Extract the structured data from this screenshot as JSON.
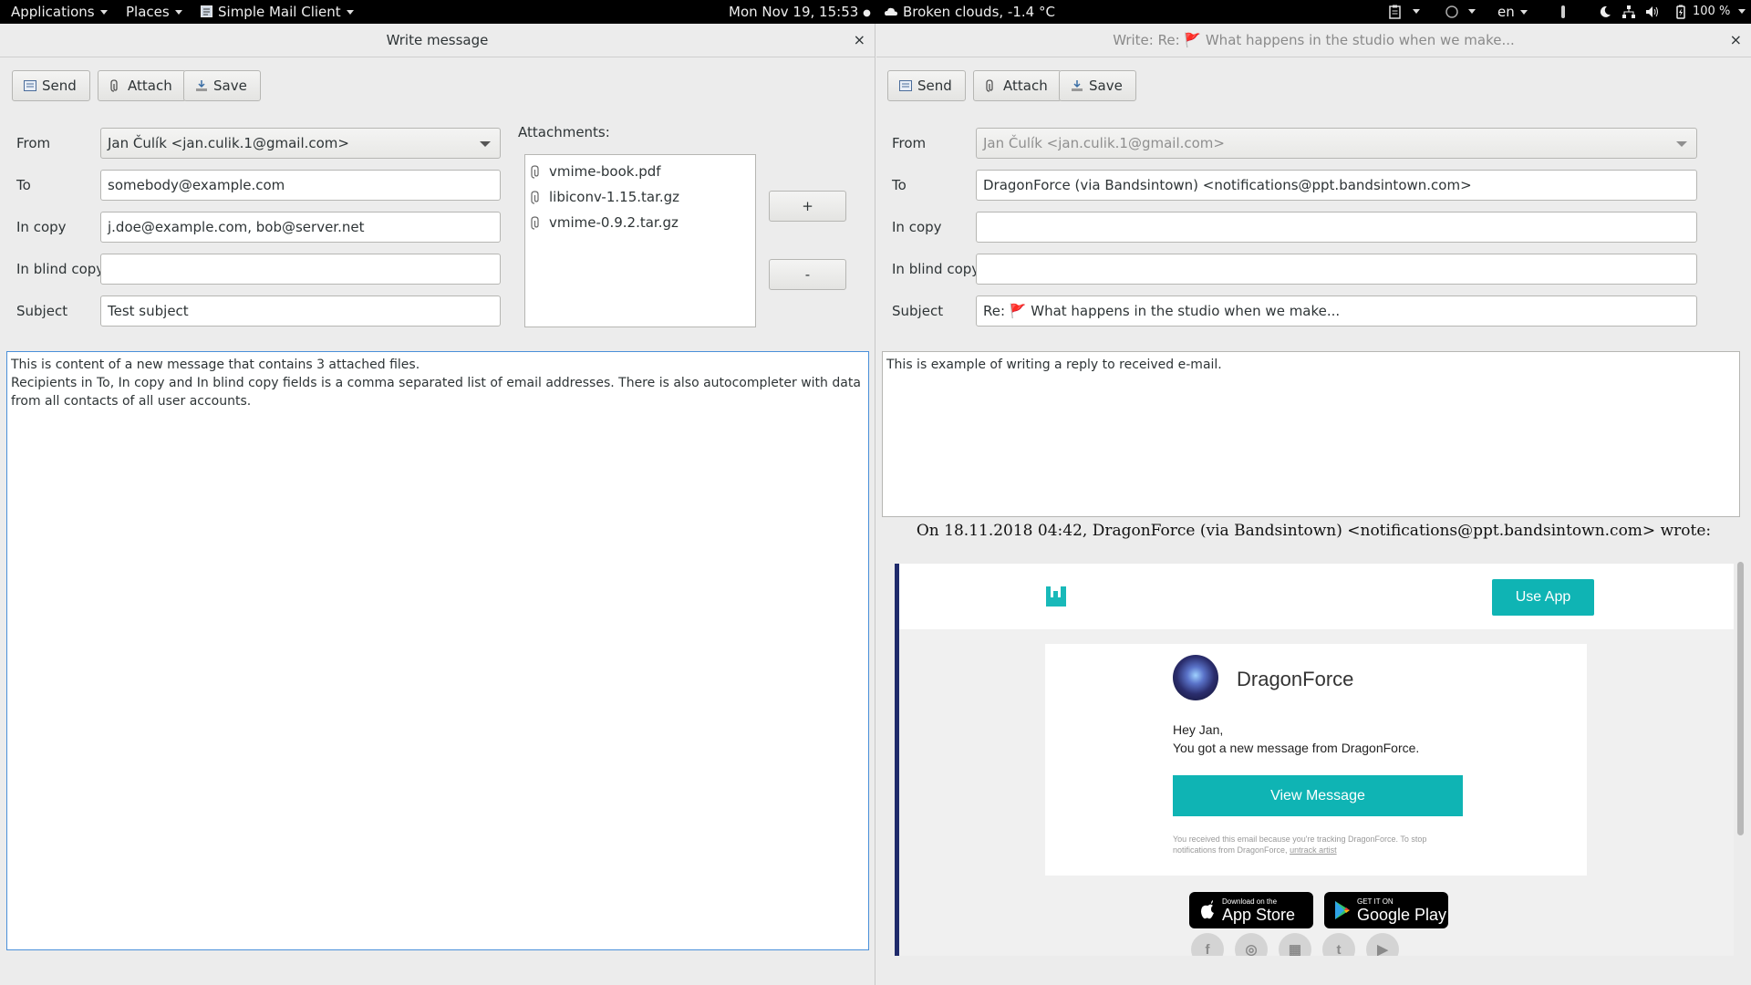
{
  "topbar": {
    "applications": "Applications",
    "places": "Places",
    "app_name": "Simple Mail Client",
    "clock": "Mon Nov 19, 15:53",
    "weather": "Broken clouds, -1.4 °C",
    "language": "en",
    "battery": "100 %"
  },
  "left": {
    "title": "Write message",
    "close": "×",
    "toolbar": {
      "send": "Send",
      "attach": "Attach",
      "save": "Save"
    },
    "labels": {
      "from": "From",
      "to": "To",
      "cc": "In copy",
      "bcc": "In blind copy",
      "subject": "Subject",
      "attachments": "Attachments:"
    },
    "values": {
      "from": "Jan Čulík <jan.culik.1@gmail.com>",
      "to": "somebody@example.com",
      "cc": "j.doe@example.com, bob@server.net",
      "bcc": "",
      "subject": "Test subject"
    },
    "attachments": [
      "vmime-book.pdf",
      "libiconv-1.15.tar.gz",
      "vmime-0.9.2.tar.gz"
    ],
    "add_button": "+",
    "remove_button": "-",
    "body_lines": [
      "This is content of a new message that contains 3 attached files.",
      "Recipients in To, In copy and In blind copy fields is a comma separated list of email addresses. There is also autocompleter with data from all contacts of all user accounts."
    ]
  },
  "right": {
    "title": "Write: Re: 🚩 What happens in the studio when we make...",
    "close": "×",
    "toolbar": {
      "send": "Send",
      "attach": "Attach",
      "save": "Save"
    },
    "labels": {
      "from": "From",
      "to": "To",
      "cc": "In copy",
      "bcc": "In blind copy",
      "subject": "Subject"
    },
    "values": {
      "from": "Jan Čulík <jan.culik.1@gmail.com>",
      "to": "DragonForce (via Bandsintown) <notifications@ppt.bandsintown.com>",
      "cc": "",
      "bcc": "",
      "subject": "Re: 🚩 What happens in the studio when we make..."
    },
    "body": "This is example of writing a reply to received e-mail.",
    "quote_header": "On 18.11.2018 04:42, DragonForce (via Bandsintown) <notifications@ppt.bandsintown.com> wrote:",
    "email": {
      "use_app": "Use App",
      "artist": "DragonForce",
      "greeting": "Hey Jan,",
      "message": "You got a new message from DragonForce.",
      "view_message": "View Message",
      "fineprint": "You received this email because you're tracking DragonForce. To stop notifications from DragonForce,",
      "untrack": "untrack artist",
      "appstore_small": "Download on the",
      "appstore_big": "App Store",
      "googleplay_small": "GET IT ON",
      "googleplay_big": "Google Play",
      "social": [
        "f",
        "◎",
        "▦",
        "t",
        "▶"
      ]
    }
  }
}
